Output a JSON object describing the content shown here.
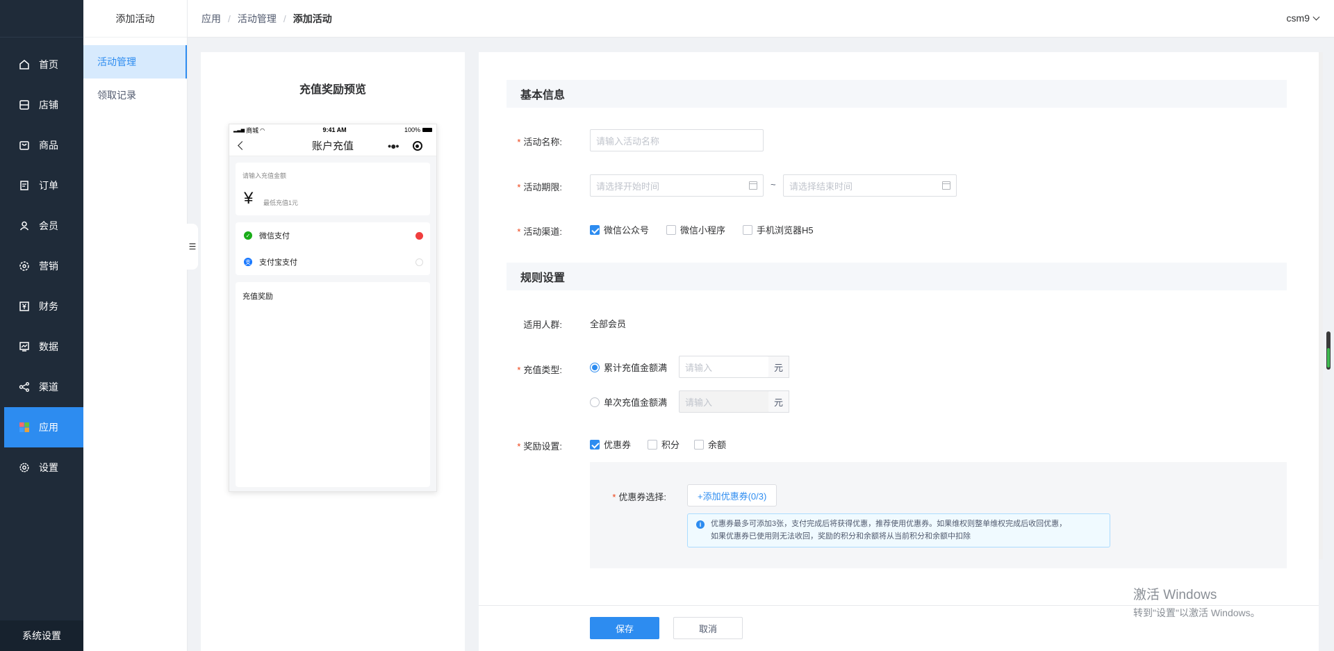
{
  "sidebar": {
    "items": [
      {
        "label": "首页",
        "icon": "home-icon"
      },
      {
        "label": "店铺",
        "icon": "store-icon"
      },
      {
        "label": "商品",
        "icon": "goods-icon"
      },
      {
        "label": "订单",
        "icon": "order-icon"
      },
      {
        "label": "会员",
        "icon": "member-icon"
      },
      {
        "label": "营销",
        "icon": "marketing-icon"
      },
      {
        "label": "财务",
        "icon": "finance-icon"
      },
      {
        "label": "数据",
        "icon": "data-icon"
      },
      {
        "label": "渠道",
        "icon": "channel-icon"
      },
      {
        "label": "应用",
        "icon": "apps-icon"
      },
      {
        "label": "设置",
        "icon": "settings-icon"
      }
    ],
    "active": "应用",
    "bottom_label": "系统设置"
  },
  "submenu": {
    "title": "添加活动",
    "items": [
      "活动管理",
      "领取记录"
    ],
    "active": "活动管理"
  },
  "header": {
    "breadcrumb": [
      "应用",
      "活动管理",
      "添加活动"
    ],
    "user": "csm9"
  },
  "preview": {
    "title": "充值奖励预览",
    "status_left": "商城",
    "status_time": "9:41 AM",
    "status_right": "100%",
    "nav_title": "账户充值",
    "amount_label": "请输入充值金额",
    "currency": "¥",
    "min_hint": "最低充值1元",
    "pay_methods": [
      "微信支付",
      "支付宝支付"
    ],
    "reward_label": "充值奖励"
  },
  "form": {
    "basic_section": "基本信息",
    "name_label": "活动名称:",
    "name_placeholder": "请输入活动名称",
    "period_label": "活动期限:",
    "start_placeholder": "请选择开始时间",
    "end_placeholder": "请选择结束时间",
    "tilde": "~",
    "channel_label": "活动渠道:",
    "channels": [
      {
        "label": "微信公众号",
        "checked": true
      },
      {
        "label": "微信小程序",
        "checked": false
      },
      {
        "label": "手机浏览器H5",
        "checked": false
      }
    ],
    "rule_section": "规则设置",
    "audience_label": "适用人群:",
    "audience_value": "全部会员",
    "type_label": "充值类型:",
    "types": [
      {
        "label": "累计充值金额满",
        "selected": true,
        "placeholder": "请输入",
        "unit": "元"
      },
      {
        "label": "单次充值金额满",
        "selected": false,
        "placeholder": "请输入",
        "unit": "元"
      }
    ],
    "reward_label": "奖励设置:",
    "rewards": [
      {
        "label": "优惠券",
        "checked": true
      },
      {
        "label": "积分",
        "checked": false
      },
      {
        "label": "余额",
        "checked": false
      }
    ],
    "coupon_label": "优惠券选择:",
    "add_coupon": "+添加优惠券(0/3)",
    "notice_line1": "优惠券最多可添加3张，支付完成后将获得优惠，推荐使用优惠券。如果维权则整单维权完成后收回优惠，",
    "notice_line2": "如果优惠券已使用则无法收回，奖励的积分和余额将从当前积分和余额中扣除",
    "save": "保存",
    "cancel": "取消"
  },
  "watermark": {
    "line1": "激活 Windows",
    "line2": "转到\"设置\"以激活 Windows。"
  },
  "colors": {
    "primary": "#2d8cf0",
    "sidebar_bg": "#1f2b39",
    "required": "#ed4014"
  }
}
